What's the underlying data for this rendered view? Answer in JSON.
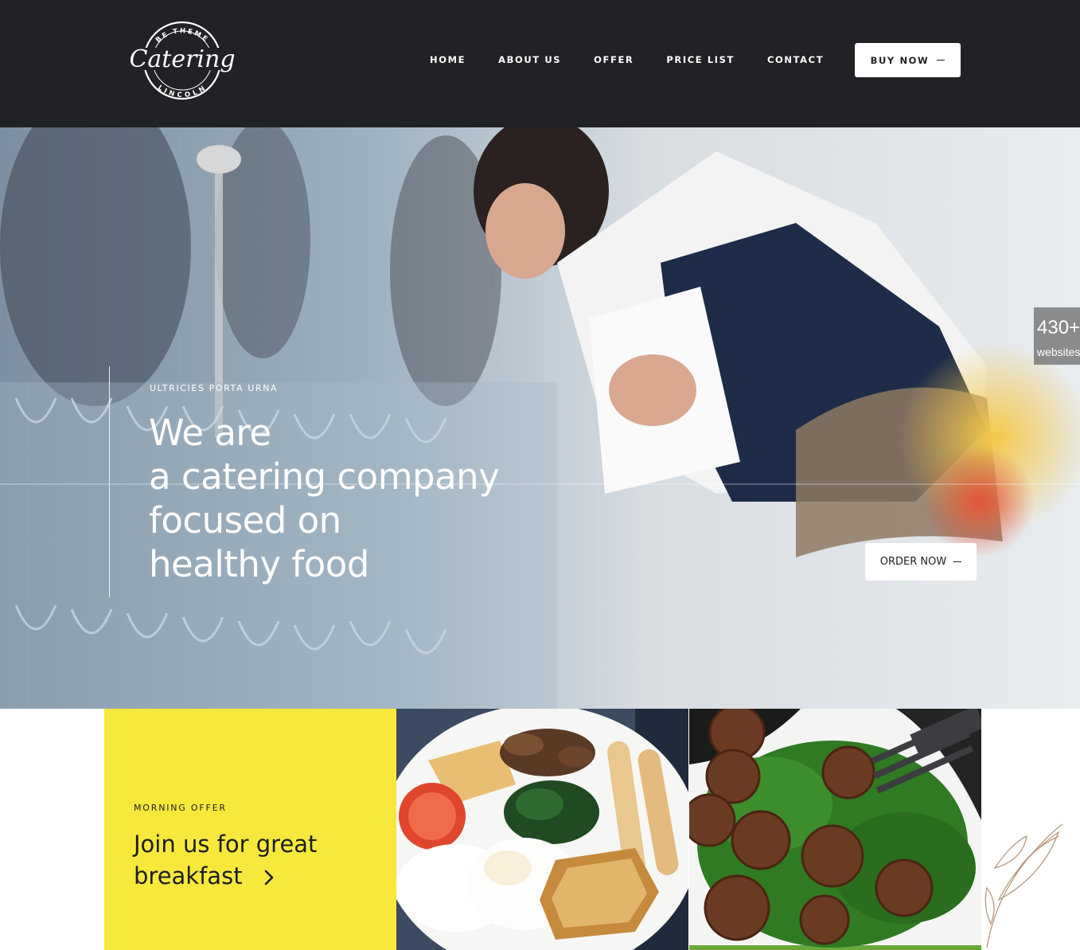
{
  "header": {
    "logo": {
      "icon": "catering-badge-logo",
      "wordmark": "Catering",
      "top_arc": "BE THEME",
      "bottom_arc": "LINCOLN"
    },
    "nav": [
      "HOME",
      "ABOUT US",
      "OFFER",
      "PRICE LIST",
      "CONTACT"
    ],
    "buy_button": "BUY NOW"
  },
  "hero": {
    "eyebrow": "ULTRICIES PORTA URNA",
    "title_lines": [
      "We are",
      "a catering company",
      "focused on",
      "healthy food"
    ],
    "order_button": "ORDER NOW",
    "badge": {
      "number": "430+",
      "label": "websites"
    }
  },
  "offer": {
    "eyebrow": "MORNING OFFER",
    "title_lines": [
      "Join us for great",
      "breakfast"
    ],
    "arrow_icon": "chevron-right-icon"
  },
  "colors": {
    "header_bg": "#212226",
    "offer_bg": "#f8e83c",
    "text_dark": "#1d1d1d",
    "white": "#ffffff"
  }
}
